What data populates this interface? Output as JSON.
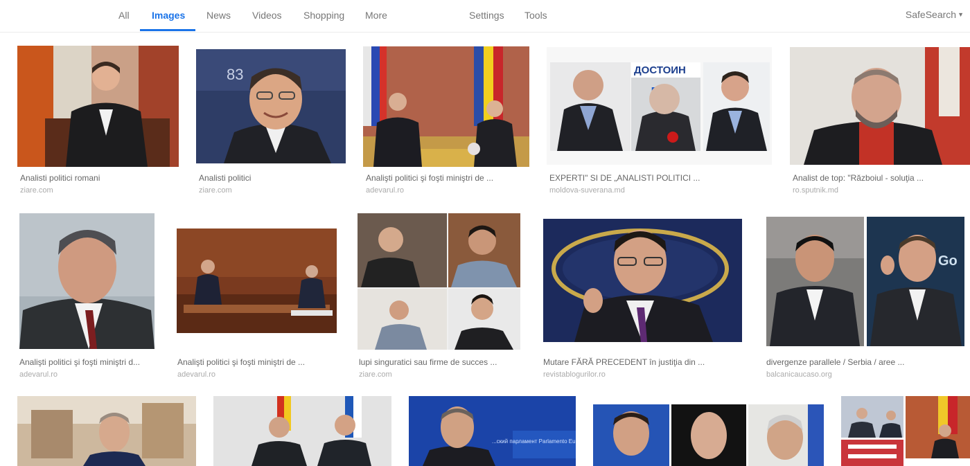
{
  "nav": {
    "tabs": [
      {
        "label": "All"
      },
      {
        "label": "Images"
      },
      {
        "label": "News"
      },
      {
        "label": "Videos"
      },
      {
        "label": "Shopping"
      },
      {
        "label": "More"
      }
    ],
    "settings": "Settings",
    "tools": "Tools",
    "safesearch": "SafeSearch"
  },
  "results": [
    {
      "caption": "Analisti politici romani",
      "source": "ziare.com"
    },
    {
      "caption": "Analisti politici",
      "source": "ziare.com"
    },
    {
      "caption": "Analişti politici şi foşti miniştri de ...",
      "source": "adevarul.ro"
    },
    {
      "caption": "EXPERTI\" SI DE „ANALISTI POLITICI ...",
      "source": "moldova-suverana.md"
    },
    {
      "caption": "Analist de top: \"Războiul - soluţia ...",
      "source": "ro.sputnik.md"
    },
    {
      "caption": "Analişti politici şi foşti miniştri d...",
      "source": "adevarul.ro"
    },
    {
      "caption": "Analişti politici şi foşti miniştri de ...",
      "source": "adevarul.ro"
    },
    {
      "caption": "lupi singuratici sau firme de succes ...",
      "source": "ziare.com"
    },
    {
      "caption": "Mutare FĂRĂ PRECEDENT în justiţia din ...",
      "source": "revistablogurilor.ro"
    },
    {
      "caption": "divergenze parallele / Serbia / aree ...",
      "source": "balcanicaucaso.org"
    }
  ],
  "image_text": {
    "dostoin": "ДОСТОИН",
    "pr": "PR",
    "number": "83",
    "go": "Go",
    "parliament": "...ский парламент  Parlamento Eu..."
  },
  "colors": {
    "accent": "#1a73e8",
    "caption": "#666666",
    "source": "#aaaaaa"
  }
}
